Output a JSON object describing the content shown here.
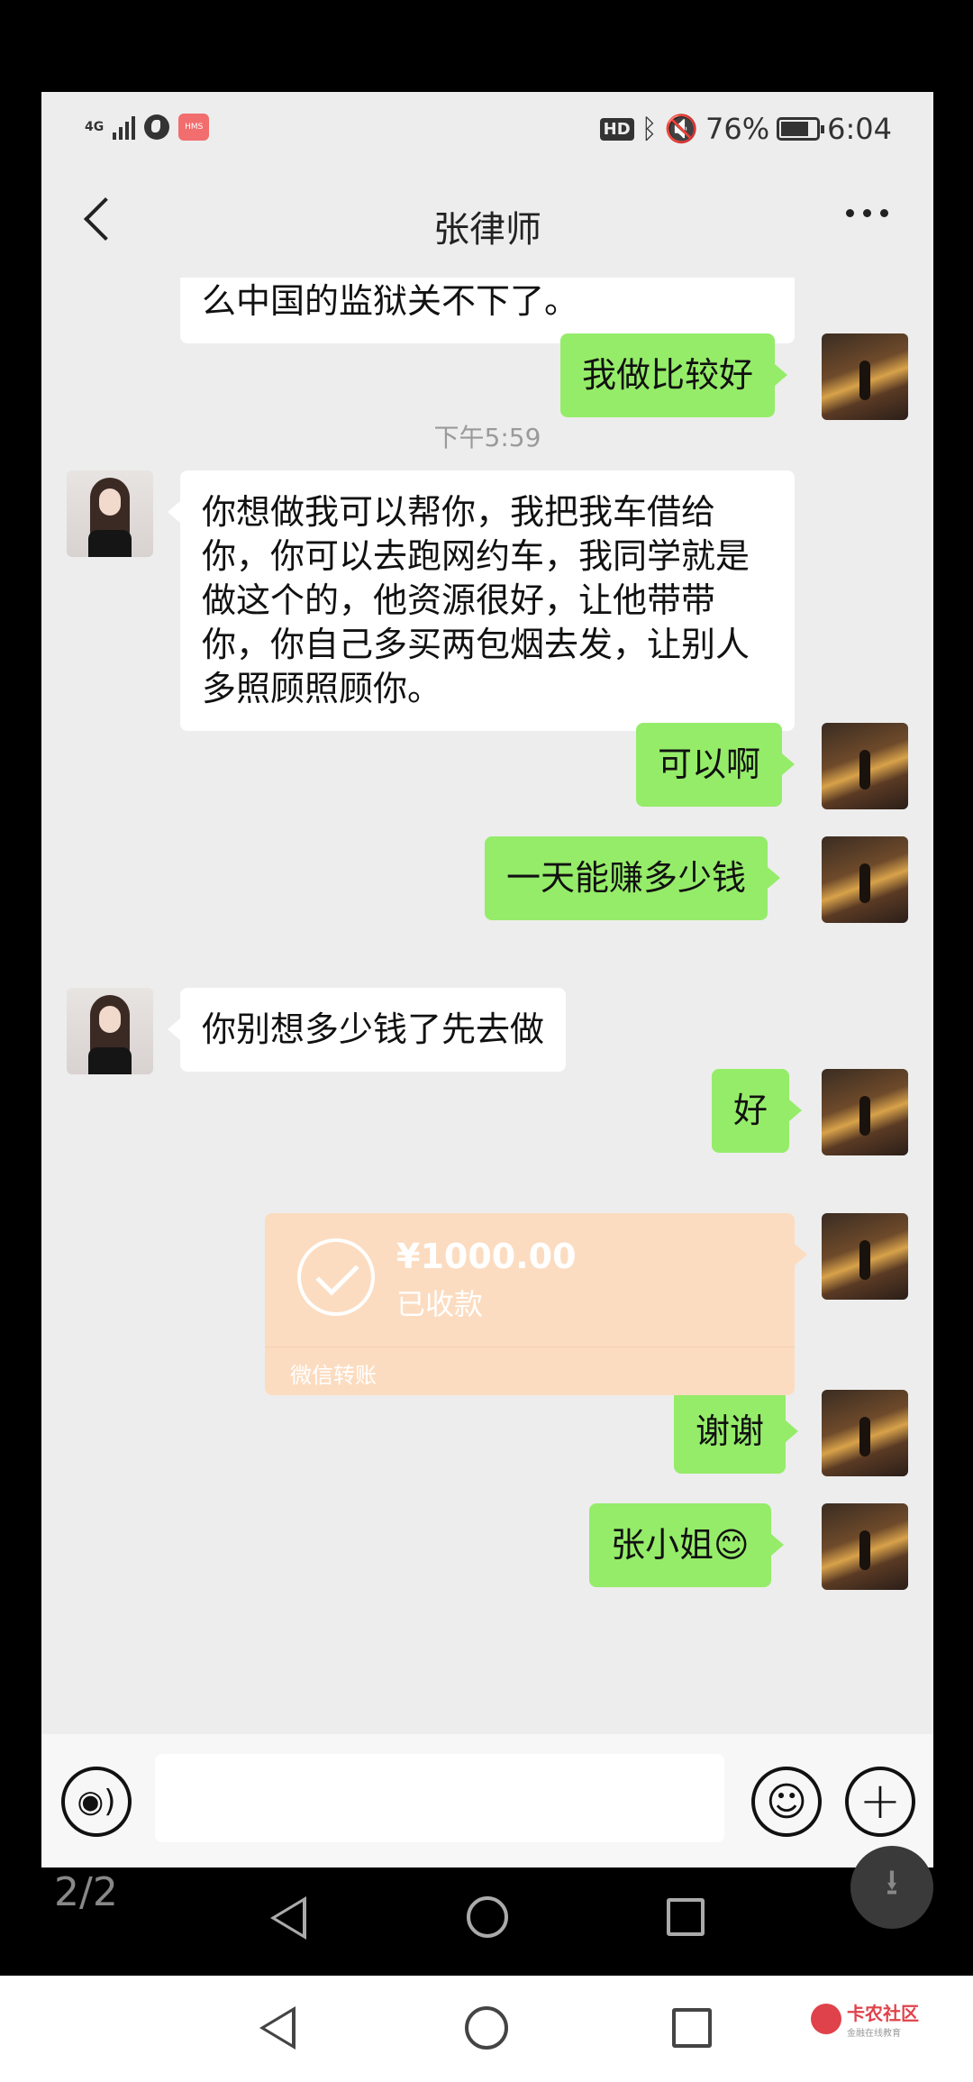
{
  "status_bar": {
    "network": "4G",
    "hms_label": "HMS",
    "hd_label": "HD",
    "battery_pct": "76%",
    "time": "6:04"
  },
  "header": {
    "title": "张律师"
  },
  "messages": {
    "m0_text": "么中国的监狱关不下了。",
    "m1_text": "我做比较好",
    "timestamp": "下午5:59",
    "m2_text": "你想做我可以帮你，我把我车借给你，你可以去跑网约车，我同学就是做这个的，他资源很好，让他带带你，你自己多买两包烟去发，让别人多照顾照顾你。",
    "m3_text": "可以啊",
    "m4_text": "一天能赚多少钱",
    "m5_text": "你别想多少钱了先去做",
    "m6_text": "好",
    "transfer_amount": "¥1000.00",
    "transfer_status": "已收款",
    "transfer_type": "微信转账",
    "m8_text": "谢谢",
    "m9_text": "张小姐😊"
  },
  "overlay": {
    "page_counter": "2/2"
  },
  "watermark": {
    "main": "卡农社区",
    "sub": "金融在线教育"
  },
  "icons": {
    "back": "back-chevron-icon",
    "more": "more-dots-icon",
    "voice": "voice-icon",
    "emoji": "emoji-icon",
    "plus": "plus-icon",
    "download": "download-icon"
  }
}
